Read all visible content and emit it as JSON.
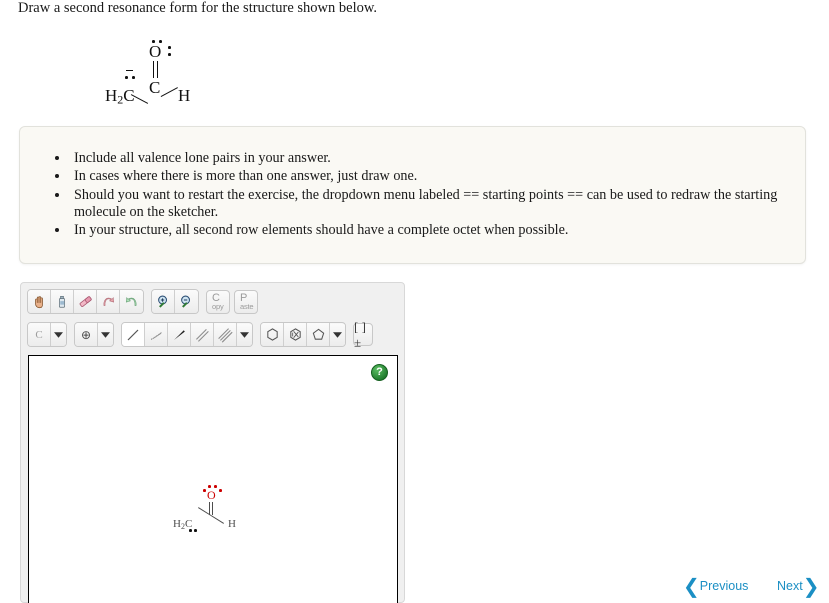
{
  "prompt": {
    "text": "Draw a second resonance form for the structure shown below."
  },
  "structure": {
    "oxygen_label": "O",
    "carbon_label": "C",
    "methylene_label": "H",
    "methylene_sub": "2",
    "methylene_c": "C",
    "hydrogen_label": "H",
    "charge": "–",
    "bond_oxygen_carbon": "double",
    "bond_carbon_ch2": "single",
    "bond_carbon_h": "single"
  },
  "instructions": {
    "items": [
      "Include all valence lone pairs in your answer.",
      "In cases where there is more than one answer, just draw one.",
      "Should you want to restart the exercise, the dropdown menu labeled == starting points == can be used to redraw the starting molecule on the sketcher.",
      "In your structure, all second row elements should have a complete octet when possible."
    ]
  },
  "sketcher": {
    "toolbar_row1": [
      {
        "name": "pan-hand-icon",
        "label": ""
      },
      {
        "name": "eraser-clear-icon",
        "label": ""
      },
      {
        "name": "eraser-icon",
        "label": ""
      },
      {
        "name": "undo-icon",
        "label": ""
      },
      {
        "name": "redo-icon",
        "label": ""
      },
      {
        "name": "zoom-in-icon",
        "label": ""
      },
      {
        "name": "zoom-out-icon",
        "label": ""
      }
    ],
    "copy_button": {
      "big": "C",
      "small": "opy"
    },
    "paste_button": {
      "big": "P",
      "small": "aste"
    },
    "element_button": {
      "label": "C"
    },
    "charge_button": {
      "label": "⊕"
    },
    "bond_buttons": [
      {
        "name": "single-bond-icon",
        "selected": true
      },
      {
        "name": "hash-wedge-bond-icon",
        "selected": false
      },
      {
        "name": "bold-wedge-bond-icon",
        "selected": false
      },
      {
        "name": "double-bond-icon",
        "selected": false
      },
      {
        "name": "triple-bond-icon",
        "selected": false
      }
    ],
    "ring_buttons": [
      {
        "name": "cyclohexane-ring-icon"
      },
      {
        "name": "benzene-ring-icon"
      },
      {
        "name": "cyclopentane-ring-icon"
      }
    ],
    "bracket_button": {
      "label": "[ ]±"
    },
    "help_button": {
      "label": "?"
    },
    "canvas_molecule": {
      "oxygen_label": "O",
      "methylene_label": "H",
      "methylene_sub": "2",
      "methylene_c": "C",
      "hydrogen_label": "H"
    }
  },
  "navigation": {
    "previous_label": "Previous",
    "next_label": "Next",
    "previous_chevron": "❮",
    "next_chevron": "❯"
  },
  "colors": {
    "accent": "#1b8fc4",
    "oxygen_red": "#cc0000",
    "panel_bg": "#faf9f4",
    "help_green": "#1e7a2c"
  }
}
